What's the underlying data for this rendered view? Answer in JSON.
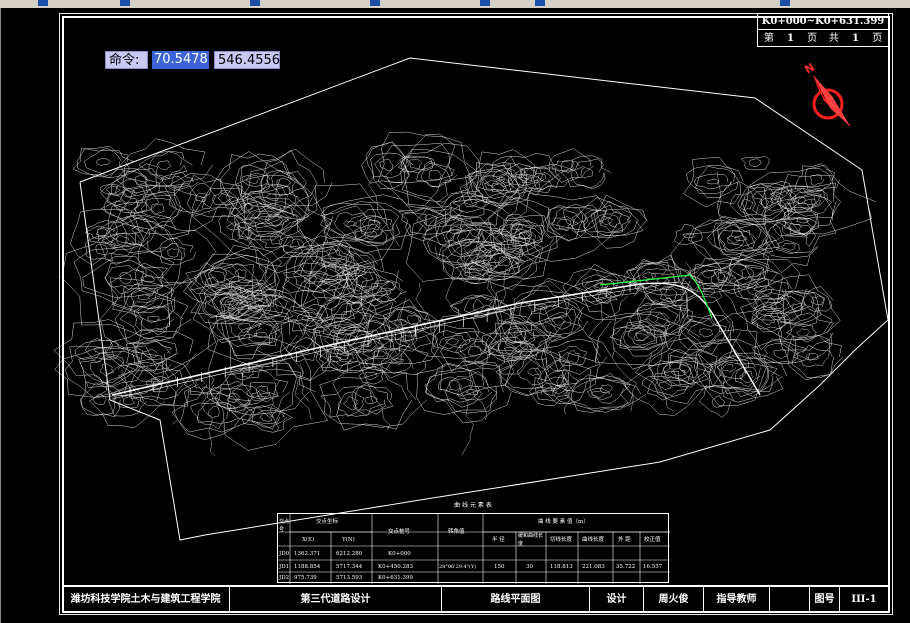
{
  "command": {
    "label": "命令:",
    "x_value": "70.5478",
    "y_value": "546.4556"
  },
  "sheet": {
    "range": "K0+000~K0+631.399",
    "sheet_prefix": "第",
    "sheet_no": "1",
    "sheet_unit": "页",
    "total_prefix": "共",
    "total_no": "1",
    "total_unit": "页"
  },
  "compass": {
    "north_label": "N"
  },
  "curve_table": {
    "title": "曲 线 元 素 表",
    "headers": [
      "交点号",
      "交点坐标",
      "交点桩号",
      "转角值",
      "曲 线 要 素 值（m）"
    ],
    "sub_headers": [
      "X(E)",
      "Y(N)",
      "半 径",
      "缓和曲线长度",
      "切线长度",
      "曲线长度",
      "外 距",
      "校正值"
    ],
    "rows": [
      {
        "jd": "JD0",
        "x": "1362.371",
        "y": "6212.280",
        "station": "K0+000",
        "angle": "",
        "r": "",
        "ls": "",
        "t": "",
        "l": "",
        "e": "",
        "j": ""
      },
      {
        "jd": "JD1",
        "x": "1188.854",
        "y": "5717.344",
        "station": "K0+450.283",
        "angle": "28°06'29.4\"(Y)",
        "r": "150",
        "ls": "30",
        "t": "118.813",
        "l": "221.083",
        "e": "35.722",
        "j": "16.557"
      },
      {
        "jd": "JD2",
        "x": "975.739",
        "y": "5713.593",
        "station": "K0+631.399",
        "angle": "",
        "r": "",
        "ls": "",
        "t": "",
        "l": "",
        "e": "",
        "j": ""
      }
    ]
  },
  "title_block": {
    "school": "潍坊科技学院土木与建筑工程学院",
    "course": "第三代道路设计",
    "drawing": "路线平面图",
    "design_label": "设计",
    "designer": "周火俊",
    "advisor_label": "指导教师",
    "advisor": "",
    "figure_label": "图号",
    "figure_no": "III-1"
  },
  "colors": {
    "background": "#000000",
    "linework": "#ffffff",
    "route_highlight": "#00ff33",
    "compass_red": "#ff2020",
    "command_bg": "#c9c9f3",
    "selected_bg": "#3b62d6"
  }
}
